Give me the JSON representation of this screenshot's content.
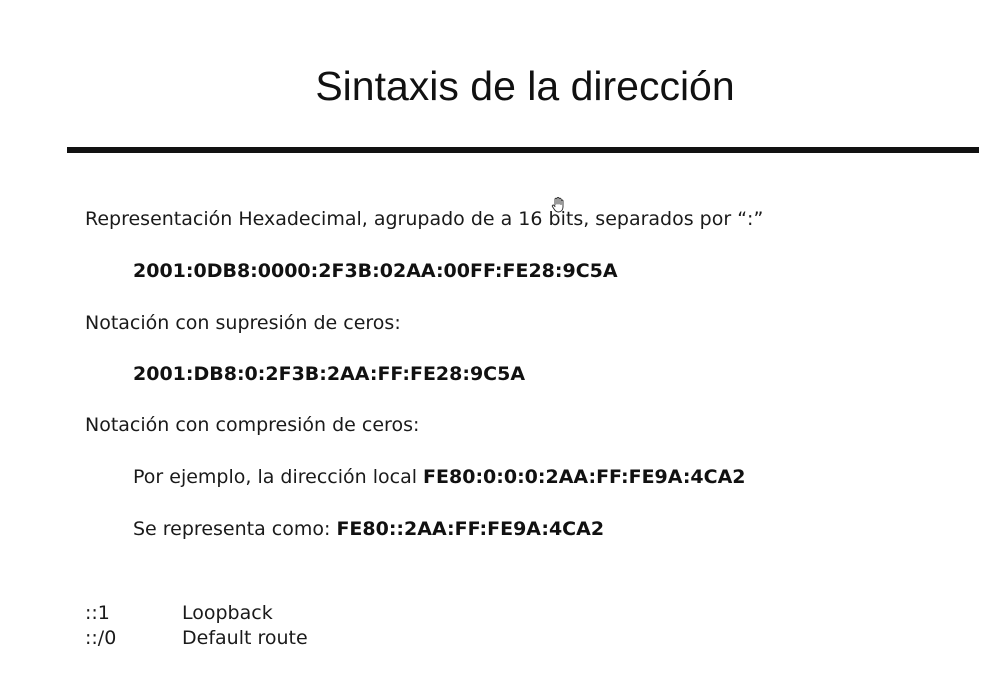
{
  "slide": {
    "title": "Sintaxis de la dirección",
    "hex_description": "Representación Hexadecimal, agrupado de a 16 bits, separados por “:”",
    "hex_address": "2001:0DB8:0000:2F3B:02AA:00FF:FE28:9C5A",
    "suppression_description": "Notación con supresión de ceros:",
    "suppression_address": "2001:DB8:0:2F3B:2AA:FF:FE28:9C5A",
    "compression_description": "Notación con compresión de ceros:",
    "example_prefix": "Por ejemplo, la dirección local ",
    "example_address": "FE80:0:0:0:2AA:FF:FE9A:4CA2",
    "represented_prefix": "Se representa como: ",
    "represented_address": "FE80::2AA:FF:FE9A:4CA2",
    "special_addresses": [
      {
        "code": "::1",
        "meaning": "Loopback"
      },
      {
        "code": "::/0",
        "meaning": "Default route"
      }
    ]
  },
  "icons": {
    "cursor": "hand-pointer-icon"
  },
  "colors": {
    "text": "#111111",
    "background": "#ffffff",
    "rule": "#111111"
  }
}
